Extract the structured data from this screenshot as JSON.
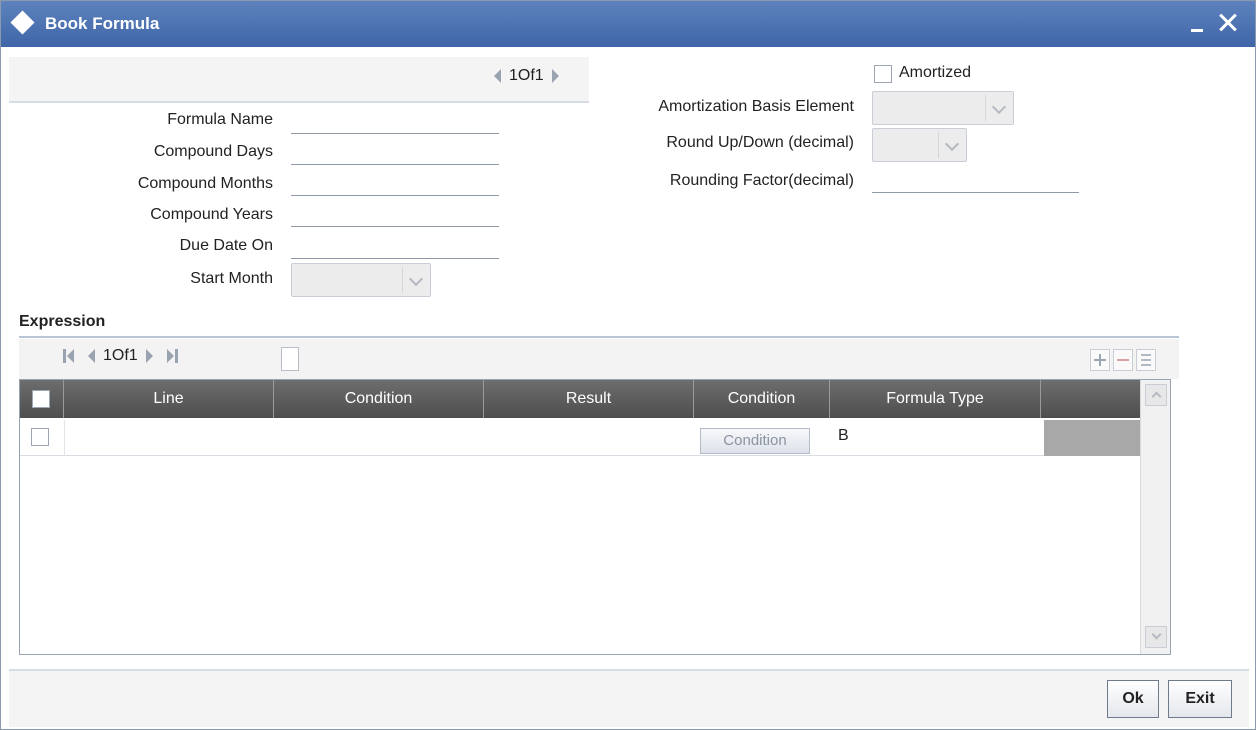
{
  "window": {
    "title": "Book Formula"
  },
  "header_pager": {
    "text": "1Of1"
  },
  "fields": {
    "formula_name": "Formula Name",
    "compound_days": "Compound Days",
    "compound_months": "Compound Months",
    "compound_years": "Compound Years",
    "due_date_on": "Due Date On",
    "start_month": "Start Month",
    "amortized": "Amortized",
    "amortization_basis_element": "Amortization Basis Element",
    "round_up_down": "Round Up/Down (decimal)",
    "rounding_factor": "Rounding Factor(decimal)"
  },
  "expression": {
    "title": "Expression",
    "pager_text": "1Of1",
    "columns": [
      "Line",
      "Condition",
      "Result",
      "Condition",
      "Formula Type"
    ],
    "rows": [
      {
        "condition_button": "Condition",
        "formula_type": "B"
      }
    ]
  },
  "buttons": {
    "ok": "Ok",
    "exit": "Exit"
  },
  "colors": {
    "titlebar": "#4a70b0",
    "grid_header": "#5e5e5e"
  }
}
